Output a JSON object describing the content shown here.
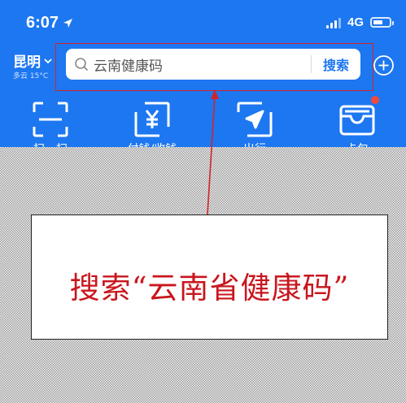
{
  "status_bar": {
    "time": "6:07",
    "network": "4G"
  },
  "location": {
    "city": "昆明",
    "weather": "多云 15°C"
  },
  "search": {
    "query": "云南健康码",
    "button_label": "搜索"
  },
  "shortcuts": [
    {
      "label": "扫一扫",
      "icon": "scan-icon"
    },
    {
      "label": "付钱/收钱",
      "icon": "payment-icon"
    },
    {
      "label": "出行",
      "icon": "travel-icon"
    },
    {
      "label": "卡包",
      "icon": "card-wallet-icon"
    }
  ],
  "annotation": {
    "instruction": "搜索“云南省健康码”"
  },
  "colors": {
    "brand_blue": "#1d77f1",
    "annotation_red": "#c8161d",
    "badge_red": "#f04a3e"
  }
}
